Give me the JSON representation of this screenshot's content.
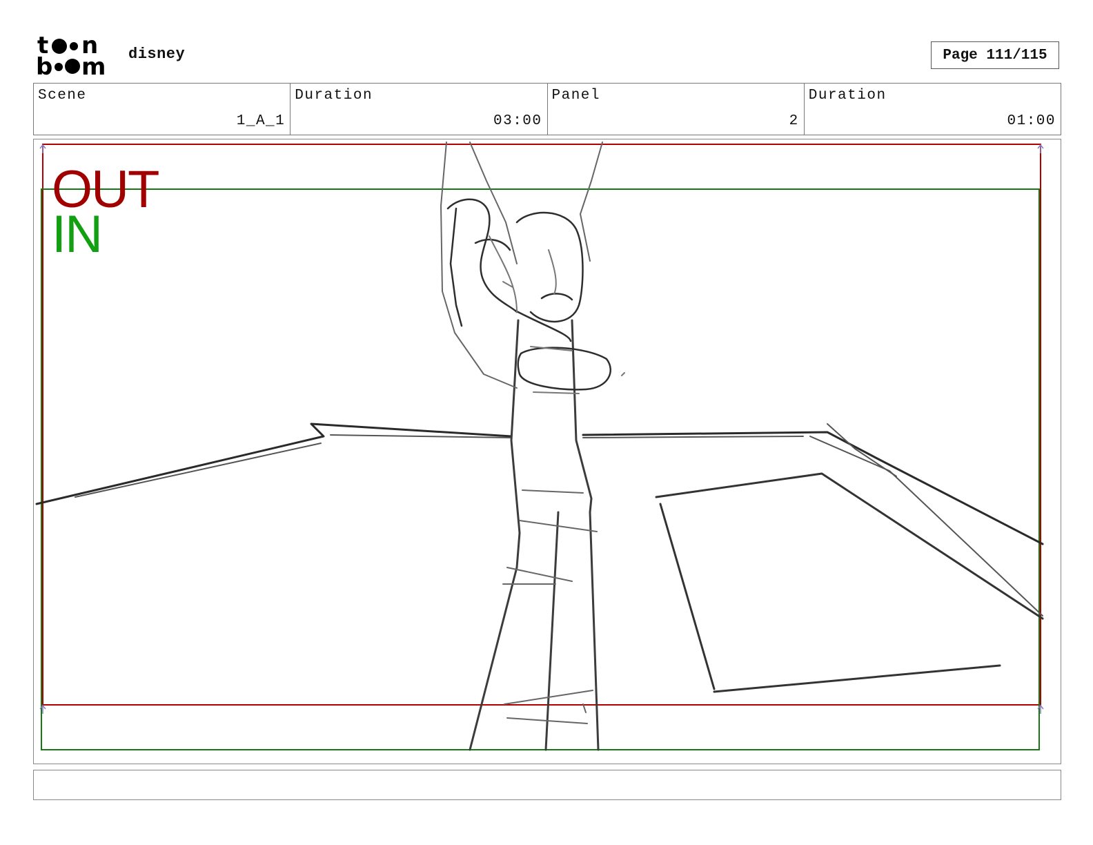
{
  "header": {
    "logo_text": "toon\nboom",
    "logo_alt": "toon boom",
    "project": "disney",
    "page": "Page 111/115"
  },
  "info": {
    "scene_label": "Scene",
    "scene_value": "1_A_1",
    "scene_duration_label": "Duration",
    "scene_duration_value": "03:00",
    "panel_label": "Panel",
    "panel_value": "2",
    "panel_duration_label": "Duration",
    "panel_duration_value": "01:00"
  },
  "frame": {
    "out_label": "OUT",
    "in_label": "IN",
    "out_color": "#a00000",
    "in_color": "#12a012"
  },
  "caption": {
    "text": ""
  }
}
